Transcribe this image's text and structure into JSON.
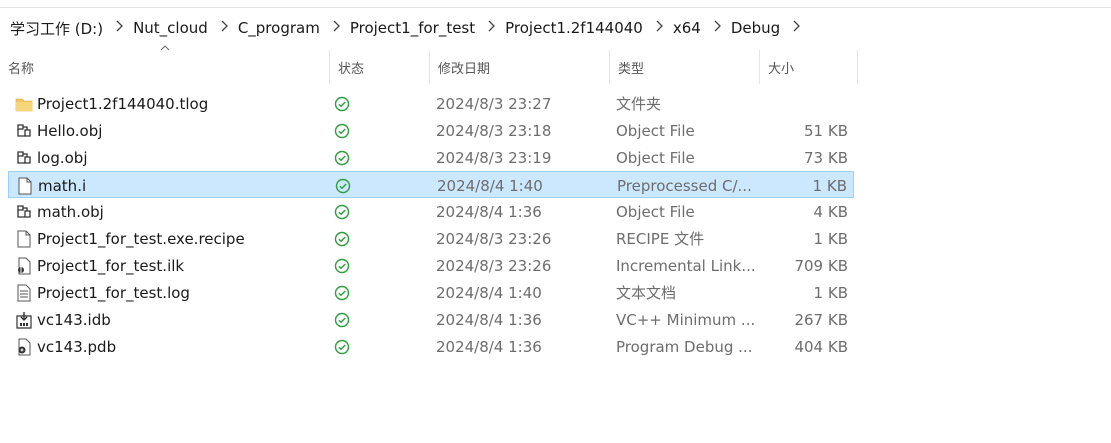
{
  "breadcrumb": [
    {
      "label": "学习工作 (D:)"
    },
    {
      "label": "Nut_cloud"
    },
    {
      "label": "C_program"
    },
    {
      "label": "Project1_for_test"
    },
    {
      "label": "Project1.2f144040"
    },
    {
      "label": "x64"
    },
    {
      "label": "Debug"
    }
  ],
  "columns": {
    "name": "名称",
    "status": "状态",
    "date": "修改日期",
    "type": "类型",
    "size": "大小"
  },
  "sort": {
    "column": "name",
    "direction": "ascending"
  },
  "files": [
    {
      "name": "Project1.2f144040.tlog",
      "icon": "folder-icon",
      "date": "2024/8/3 23:27",
      "type": "文件夹",
      "size": "",
      "selected": false
    },
    {
      "name": "Hello.obj",
      "icon": "obj-file-icon",
      "date": "2024/8/3 23:18",
      "type": "Object File",
      "size": "51 KB",
      "selected": false
    },
    {
      "name": "log.obj",
      "icon": "obj-file-icon",
      "date": "2024/8/3 23:19",
      "type": "Object File",
      "size": "73 KB",
      "selected": false
    },
    {
      "name": "math.i",
      "icon": "blank-file-icon",
      "date": "2024/8/4 1:40",
      "type": "Preprocessed C/...",
      "size": "1 KB",
      "selected": true
    },
    {
      "name": "math.obj",
      "icon": "obj-file-icon",
      "date": "2024/8/4 1:36",
      "type": "Object File",
      "size": "4 KB",
      "selected": false
    },
    {
      "name": "Project1_for_test.exe.recipe",
      "icon": "blank-file-icon",
      "date": "2024/8/3 23:26",
      "type": "RECIPE 文件",
      "size": "1 KB",
      "selected": false
    },
    {
      "name": "Project1_for_test.ilk",
      "icon": "ilk-file-icon",
      "date": "2024/8/3 23:26",
      "type": "Incremental Link...",
      "size": "709 KB",
      "selected": false
    },
    {
      "name": "Project1_for_test.log",
      "icon": "text-file-icon",
      "date": "2024/8/4 1:40",
      "type": "文本文档",
      "size": "1 KB",
      "selected": false
    },
    {
      "name": "vc143.idb",
      "icon": "idb-file-icon",
      "date": "2024/8/4 1:36",
      "type": "VC++ Minimum ...",
      "size": "267 KB",
      "selected": false
    },
    {
      "name": "vc143.pdb",
      "icon": "pdb-file-icon",
      "date": "2024/8/4 1:36",
      "type": "Program Debug ...",
      "size": "404 KB",
      "selected": false
    }
  ],
  "colors": {
    "selection_bg": "#cce8ff",
    "selection_border": "#99d1ff",
    "sync_ok": "#2e9d3f",
    "folder": "#f2c55c"
  }
}
